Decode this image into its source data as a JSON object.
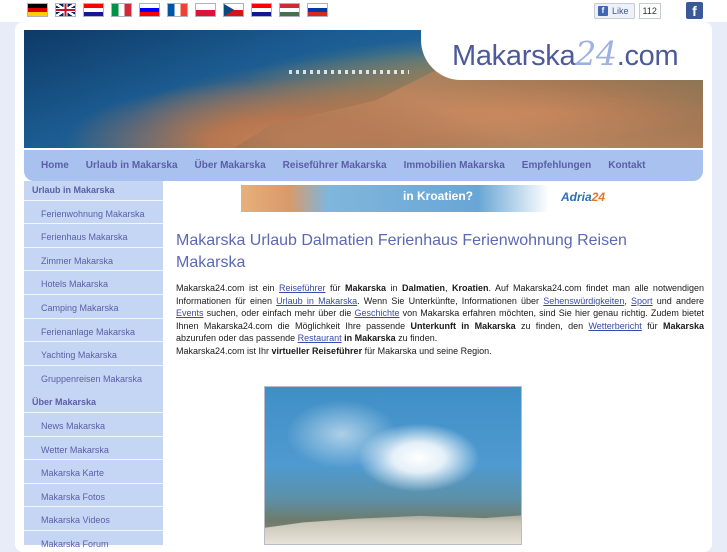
{
  "flags": [
    {
      "name": "german-flag",
      "colors": [
        "#000000",
        "#dd0000",
        "#ffce00"
      ],
      "type": "h3"
    },
    {
      "name": "uk-flag",
      "colors": [
        "#012169",
        "#ffffff",
        "#c8102e"
      ],
      "type": "uk"
    },
    {
      "name": "croatia-flag",
      "colors": [
        "#ff0000",
        "#ffffff",
        "#171796"
      ],
      "type": "h3"
    },
    {
      "name": "italy-flag",
      "colors": [
        "#009246",
        "#ffffff",
        "#ce2b37"
      ],
      "type": "v3"
    },
    {
      "name": "slovenia-flag",
      "colors": [
        "#ffffff",
        "#0000ff",
        "#ff0000"
      ],
      "type": "h3"
    },
    {
      "name": "france-flag",
      "colors": [
        "#0055a4",
        "#ffffff",
        "#ef4135"
      ],
      "type": "v3"
    },
    {
      "name": "poland-flag",
      "colors": [
        "#ffffff",
        "#dc143c"
      ],
      "type": "h2"
    },
    {
      "name": "czech-flag",
      "colors": [
        "#ffffff",
        "#d7141a",
        "#11457e"
      ],
      "type": "cz"
    },
    {
      "name": "croatia-flag-2",
      "colors": [
        "#ff0000",
        "#ffffff",
        "#171796"
      ],
      "type": "h3"
    },
    {
      "name": "hungary-flag",
      "colors": [
        "#ce2939",
        "#ffffff",
        "#477050"
      ],
      "type": "h3"
    },
    {
      "name": "russia-flag",
      "colors": [
        "#ffffff",
        "#0039a6",
        "#d52b1e"
      ],
      "type": "h3"
    }
  ],
  "facebook": {
    "like_label": "Like",
    "like_count": "112",
    "icon_letter": "f"
  },
  "logo": {
    "part1": "Makarska",
    "part2": "24",
    ".com": ".com"
  },
  "nav": [
    "Home",
    "Urlaub in Makarska",
    "Über Makarska",
    "Reiseführer Makarska",
    "Immobilien Makarska",
    "Empfehlungen",
    "Kontakt"
  ],
  "sidebar": {
    "sections": [
      {
        "label": "Urlaub in Makarska",
        "items": [
          "Ferienwohnung Makarska",
          "Ferienhaus Makarska",
          "Zimmer Makarska",
          "Hotels Makarska",
          "Camping Makarska",
          "Ferienanlage Makarska",
          "Yachting Makarska",
          "Gruppenreisen Makarska"
        ]
      },
      {
        "label": "Über Makarska",
        "items": [
          "News Makarska",
          "Wetter Makarska",
          "Makarska Karte",
          "Makarska Fotos",
          "Makarska Videos",
          "Makarska Forum"
        ]
      }
    ]
  },
  "ad": {
    "text": "in Kroatien?",
    "brand": "Adria",
    "brand_num": "24"
  },
  "main": {
    "title": "Makarska Urlaub Dalmatien Ferienhaus Ferienwohnung Reisen Makarska",
    "paragraph1": [
      {
        "t": "Makarska24.com ist ein "
      },
      {
        "t": "Reiseführer",
        "link": true
      },
      {
        "t": " für "
      },
      {
        "t": "Makarska",
        "b": true
      },
      {
        "t": " in "
      },
      {
        "t": "Dalmatien",
        "b": true
      },
      {
        "t": ", "
      },
      {
        "t": "Kroatien",
        "b": true
      },
      {
        "t": ". Auf Makarska24.com findet man alle notwendigen Informationen für einen "
      },
      {
        "t": "Urlaub in Makarska",
        "link": true
      },
      {
        "t": ". Wenn Sie Unterkünfte, Informationen über "
      },
      {
        "t": "Sehenswürdigkeiten",
        "link": true
      },
      {
        "t": ", "
      },
      {
        "t": "Sport",
        "link": true
      },
      {
        "t": " und andere "
      },
      {
        "t": "Events",
        "link": true
      },
      {
        "t": " suchen, oder einfach mehr über die "
      },
      {
        "t": "Geschichte",
        "link": true
      },
      {
        "t": " von Makarska erfahren möchten, sind Sie hier genau richtig. Zudem bietet Ihnen Makarska24.com die Möglichkeit Ihre passende "
      },
      {
        "t": "Unterkunft in Makarska",
        "b": true
      },
      {
        "t": " zu finden, den "
      },
      {
        "t": "Wetterbericht",
        "link": true
      },
      {
        "t": " für "
      },
      {
        "t": "Makarska",
        "b": true
      },
      {
        "t": " abzurufen oder das passende "
      },
      {
        "t": "Restaurant",
        "link": true
      },
      {
        "t": " "
      },
      {
        "t": "in Makarska",
        "b": true
      },
      {
        "t": " zu finden."
      }
    ],
    "paragraph2": [
      {
        "t": "Makarska24.com ist Ihr "
      },
      {
        "t": "virtueller Reiseführer",
        "b": true
      },
      {
        "t": " für Makarska und seine Region."
      }
    ]
  }
}
